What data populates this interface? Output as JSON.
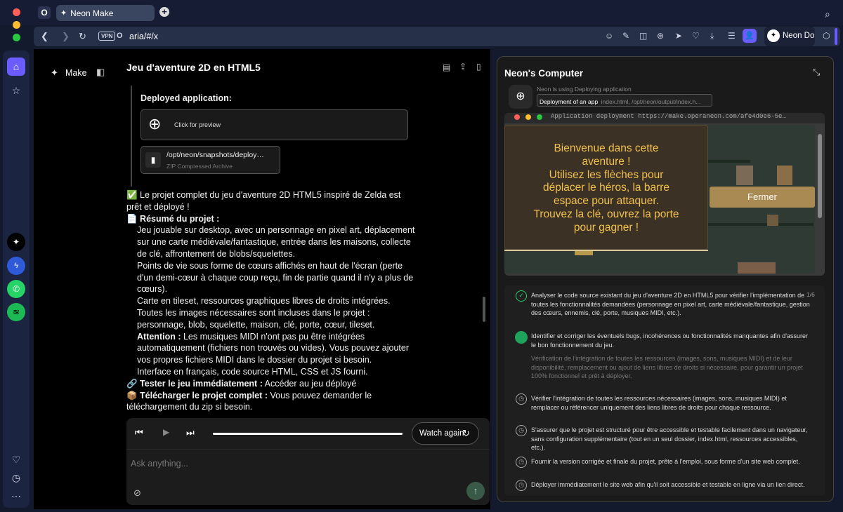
{
  "browser": {
    "tab_title": "Neon Make",
    "url": "aria/#/x",
    "vpn_label": "VPN",
    "profile_label": "Neon Do"
  },
  "main": {
    "brand_label": "Make",
    "title": "Jeu d'aventure 2D en HTML5",
    "deployed_heading": "Deployed application:",
    "preview_label": "Click for preview",
    "file_name": "/opt/neon/snapshots/deploy…",
    "file_type": "ZIP Compressed Archive",
    "messages": {
      "intro_line1": "✅ Le projet complet du jeu d'aventure 2D HTML5 inspiré de Zelda est",
      "intro_line2": "prêt et déployé !",
      "summary_heading": "📄 Résumé du projet :",
      "p1_1": "Jeu jouable sur desktop, avec un personnage en pixel art, déplacement",
      "p1_2": "sur une carte médiévale/fantastique, entrée dans les maisons, collecte",
      "p1_3": "de clé, affrontement de blobs/squelettes.",
      "p2_1": "Points de vie sous forme de cœurs affichés en haut de l'écran (perte",
      "p2_2": "d'un demi-cœur à chaque coup reçu, fin de partie quand il n'y a plus de",
      "p2_3": "cœurs).",
      "p3_1": "Carte en tileset, ressources graphiques libres de droits intégrées.",
      "p4_1": "Toutes les images nécessaires sont incluses dans le projet :",
      "p4_2": "personnage, blob, squelette, maison, clé, porte, cœur, tileset.",
      "attention_label": "Attention :",
      "p5_1": " Les musiques MIDI n'ont pas pu être intégrées",
      "p5_2": "automatiquement (fichiers non trouvés ou vides). Vous pouvez ajouter",
      "p5_3": "vos propres fichiers MIDI dans le dossier du projet si besoin.",
      "p6_1": "Interface en français, code source HTML, CSS et JS fourni.",
      "test_label": "🔗 Tester le jeu immédiatement :",
      "test_text": " Accéder au jeu déployé",
      "download_label": "📦 Télécharger le projet complet :",
      "download_text": " Vous pouvez demander le",
      "download_text2": "téléchargement du zip si besoin."
    },
    "player": {
      "watch_again": "Watch again",
      "progress": 1.0
    },
    "composer_placeholder": "Ask anything..."
  },
  "panel": {
    "title": "Neon's Computer",
    "status": "Neon is using Deploying application",
    "action_label": "Deployment of an app",
    "action_path": "index.html, /opt/neon/output/index.h...",
    "terminal_text": "Application deployment https://make.operaneon.com/afe4d0e6-5e…",
    "game_dialog": "Bienvenue dans cette aventure ! Utilisez les flèches pour déplacer le héros, la barre espace pour attaquer. Trouvez la clé, ouvrez la porte pour gagner !",
    "game_dialog_lines": [
      "Bienvenue dans cette",
      "aventure !",
      "Utilisez les flèches pour",
      "déplacer le héros, la barre",
      "espace pour attaquer.",
      "Trouvez la clé, ouvrez la porte",
      "pour gagner !"
    ],
    "close_button": "Fermer",
    "step_counter": "1/6",
    "tasks": [
      {
        "status": "done",
        "text": "Analyser le code source existant du jeu d'aventure 2D en HTML5 pour vérifier l'implémentation de toutes les fonctionnalités demandées (personnage en pixel art, carte médiévale/fantastique, gestion des cœurs, ennemis, clé, porte, musiques MIDI, etc.)."
      },
      {
        "status": "active",
        "text": "Identifier et corriger les éventuels bugs, incohérences ou fonctionnalités manquantes afin d'assurer le bon fonctionnement du jeu.",
        "subtext": "Vérification de l'intégration de toutes les ressources (images, sons, musiques MIDI) et de leur disponibilité, remplacement ou ajout de liens libres de droits si nécessaire, pour garantir un projet 100% fonctionnel et prêt à déployer."
      },
      {
        "status": "pending",
        "text": "Vérifier l'intégration de toutes les ressources nécessaires (images, sons, musiques MIDI) et remplacer ou référencer uniquement des liens libres de droits pour chaque ressource."
      },
      {
        "status": "pending",
        "text": "S'assurer que le projet est structuré pour être accessible et testable facilement dans un navigateur, sans configuration supplémentaire (tout en un seul dossier, index.html, ressources accessibles, etc.)."
      },
      {
        "status": "pending",
        "text": "Fournir la version corrigée et finale du projet, prête à l'emploi, sous forme d'un site web complet."
      },
      {
        "status": "pending",
        "text": "Déployer immédiatement le site web afin qu'il soit accessible et testable en ligne via un lien direct."
      }
    ]
  },
  "colors": {
    "accent": "#6b5cff",
    "done_green": "#2ecc71",
    "active_green": "#1fa35a",
    "dialog_bg": "#3b3124",
    "dialog_text": "#f2c14e",
    "close_bg": "#a88a52"
  }
}
